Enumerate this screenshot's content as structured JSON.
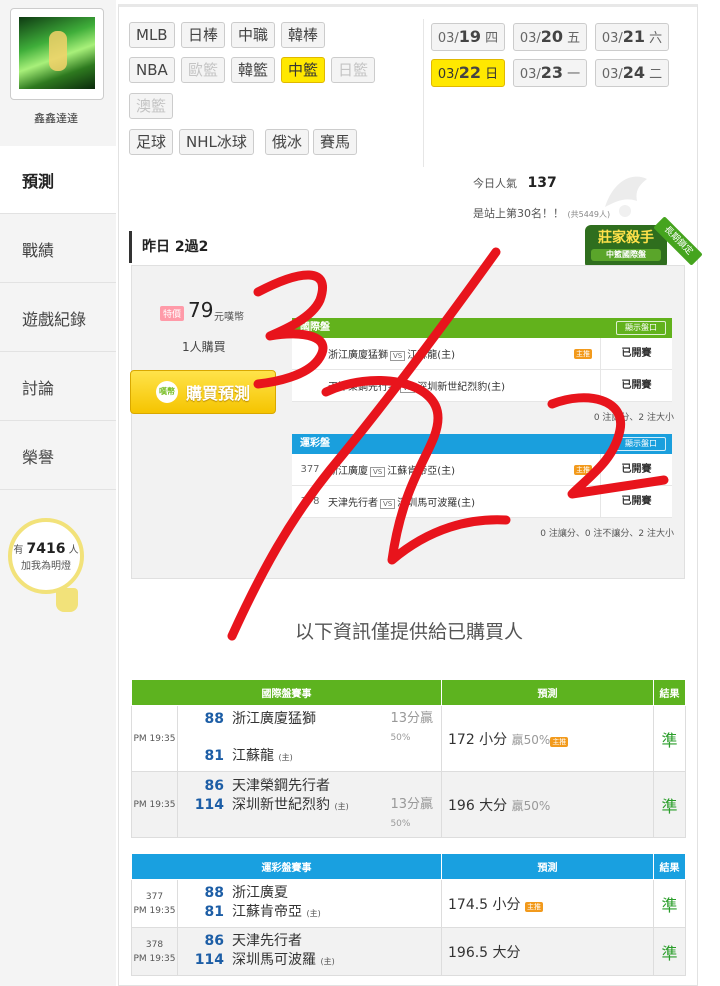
{
  "user": {
    "name": "鑫鑫達達"
  },
  "nav": {
    "items": [
      {
        "label": "預測"
      },
      {
        "label": "戰績"
      },
      {
        "label": "遊戲紀錄"
      },
      {
        "label": "討論"
      },
      {
        "label": "榮譽"
      }
    ]
  },
  "fans": {
    "prefix": "有",
    "count": "7416",
    "suffix": "人",
    "line2": "加我為明燈"
  },
  "sports": {
    "items": [
      "MLB",
      "日棒",
      "中職",
      "韓棒",
      "NBA",
      "歐籃",
      "韓籃",
      "中籃",
      "日籃",
      "澳籃",
      "足球",
      "NHL冰球",
      "俄冰",
      "賽馬"
    ],
    "selected": "中籃",
    "disabled": [
      "歐籃",
      "日籃",
      "澳籃"
    ]
  },
  "dates": {
    "items": [
      {
        "md": "03/",
        "day": "19",
        "dow": "四"
      },
      {
        "md": "03/",
        "day": "20",
        "dow": "五"
      },
      {
        "md": "03/",
        "day": "21",
        "dow": "六"
      },
      {
        "md": "03/",
        "day": "22",
        "dow": "日"
      },
      {
        "md": "03/",
        "day": "23",
        "dow": "一"
      },
      {
        "md": "03/",
        "day": "24",
        "dow": "二"
      }
    ],
    "selected": "22"
  },
  "stats": {
    "popularity_label": "今日人氣",
    "popularity_value": "137",
    "rank_text": "是站上第30名！！",
    "rank_total": "(共5449人)"
  },
  "badge": {
    "title": "莊家殺手",
    "subtitle": "中籃國際盤",
    "ribbon": "長期鎖定"
  },
  "yesterday": "昨日 2過2",
  "preview": {
    "price_tag": "特價",
    "price": "79",
    "unit": "元嘆幣",
    "buyers": "1人購買",
    "buy_label": "購買預測",
    "buy_icon": "嘆幣",
    "intl": {
      "header": "國際盤",
      "show": "顯示盤口",
      "rows": [
        {
          "no": "",
          "away": "浙江廣廈猛獅",
          "home": "江蘇龍(主)",
          "host": "主推",
          "status": "已開賽"
        },
        {
          "no": "",
          "away": "天津榮鋼先行者",
          "home": "深圳新世紀烈豹(主)",
          "host": "",
          "status": "已開賽"
        }
      ],
      "foot": "0 注讓分、2 注大小"
    },
    "lottery": {
      "header": "運彩盤",
      "show": "顯示盤口",
      "rows": [
        {
          "no": "377",
          "away": "浙江廣廈",
          "home": "江蘇肯帝亞(主)",
          "host": "主推",
          "status": "已開賽"
        },
        {
          "no": "378",
          "away": "天津先行者",
          "home": "深圳馬可波羅(主)",
          "host": "",
          "status": "已開賽"
        }
      ],
      "foot": "0 注讓分、0 注不讓分、2 注大小"
    },
    "vs": "VS"
  },
  "info_text": "以下資訊僅提供給已購買人",
  "intl_table": {
    "headers": [
      "國際盤賽事",
      "預測",
      "結果"
    ],
    "rows": [
      {
        "time": "PM 19:35",
        "away_score": "88",
        "away": "浙江廣廈猛獅",
        "home_score": "81",
        "home": "江蘇龍",
        "home_tag": "(主)",
        "hcap": "13分贏",
        "hcap_pct": "50%",
        "pred_value": "172 小分",
        "pred_pct": "贏50%",
        "pred_host": "主推",
        "result": "準"
      },
      {
        "time": "PM 19:35",
        "away_score": "86",
        "away": "天津榮鋼先行者",
        "home_score": "114",
        "home": "深圳新世紀烈豹",
        "home_tag": "(主)",
        "hcap": "13分贏",
        "hcap_pct": "50%",
        "pred_value": "196 大分",
        "pred_pct": "贏50%",
        "pred_host": "",
        "result": "準"
      }
    ]
  },
  "lottery_table": {
    "headers": [
      "運彩盤賽事",
      "預測",
      "結果"
    ],
    "rows": [
      {
        "no": "377",
        "time": "PM 19:35",
        "away_score": "88",
        "away": "浙江廣夏",
        "home_score": "81",
        "home": "江蘇肯帝亞",
        "home_tag": "(主)",
        "pred_value": "174.5 小分",
        "pred_host": "主推",
        "result": "準"
      },
      {
        "no": "378",
        "time": "PM 19:35",
        "away_score": "86",
        "away": "天津先行者",
        "home_score": "114",
        "home": "深圳馬可波羅",
        "home_tag": "(主)",
        "pred_value": "196.5 大分",
        "pred_host": "",
        "result": "準"
      }
    ]
  },
  "annotation": {
    "color": "#e8141c"
  },
  "colors": {
    "intl_green": "#5db31f",
    "lottery_blue": "#19a0e0",
    "selected_yellow": "#ffe800",
    "result_green": "#2b9e2b"
  }
}
